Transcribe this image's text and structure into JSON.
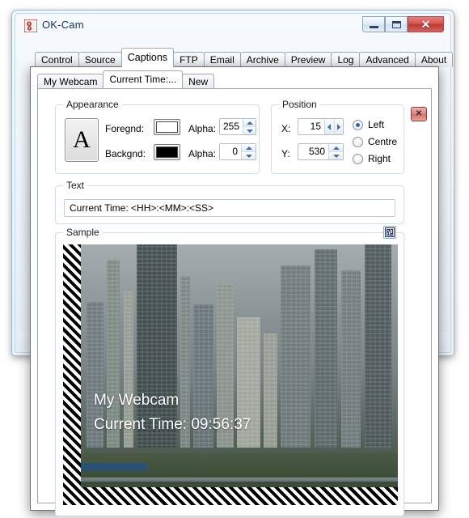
{
  "window": {
    "title": "OK-Cam",
    "icon": "app-icon",
    "buttons": {
      "minimize": "minimize-icon",
      "maximize": "maximize-icon",
      "close": "✕"
    }
  },
  "main_tabs": [
    {
      "label": "Control",
      "active": false
    },
    {
      "label": "Source",
      "active": false
    },
    {
      "label": "Captions",
      "active": true
    },
    {
      "label": "FTP",
      "active": false
    },
    {
      "label": "Email",
      "active": false
    },
    {
      "label": "Archive",
      "active": false
    },
    {
      "label": "Preview",
      "active": false
    },
    {
      "label": "Log",
      "active": false
    },
    {
      "label": "Advanced",
      "active": false
    },
    {
      "label": "About",
      "active": false
    }
  ],
  "caption_tabs": [
    {
      "label": "My Webcam",
      "active": false
    },
    {
      "label": "Current Time:...",
      "active": true
    },
    {
      "label": "New",
      "active": false
    }
  ],
  "appearance": {
    "group_title": "Appearance",
    "preview_glyph": "A",
    "foreground": {
      "label": "Foregnd:",
      "color": "#ffffff",
      "alpha_label": "Alpha:",
      "alpha_value": "255"
    },
    "background": {
      "label": "Backgnd:",
      "color": "#000000",
      "alpha_label": "Alpha:",
      "alpha_value": "0"
    }
  },
  "position": {
    "group_title": "Position",
    "x_label": "X:",
    "x_value": "15",
    "y_label": "Y:",
    "y_value": "530",
    "alignment": [
      {
        "label": "Left",
        "selected": true
      },
      {
        "label": "Centre",
        "selected": false
      },
      {
        "label": "Right",
        "selected": false
      }
    ]
  },
  "text": {
    "group_title": "Text",
    "value": "Current Time: <HH>:<MM>:<SS>"
  },
  "sample": {
    "group_title": "Sample",
    "settings_icon": "sample-config-icon",
    "overlay_line_1": "My Webcam",
    "overlay_line_2": "Current Time: 09:56:37"
  },
  "delete_button": {
    "label": "✕",
    "color": "#d4736b"
  }
}
